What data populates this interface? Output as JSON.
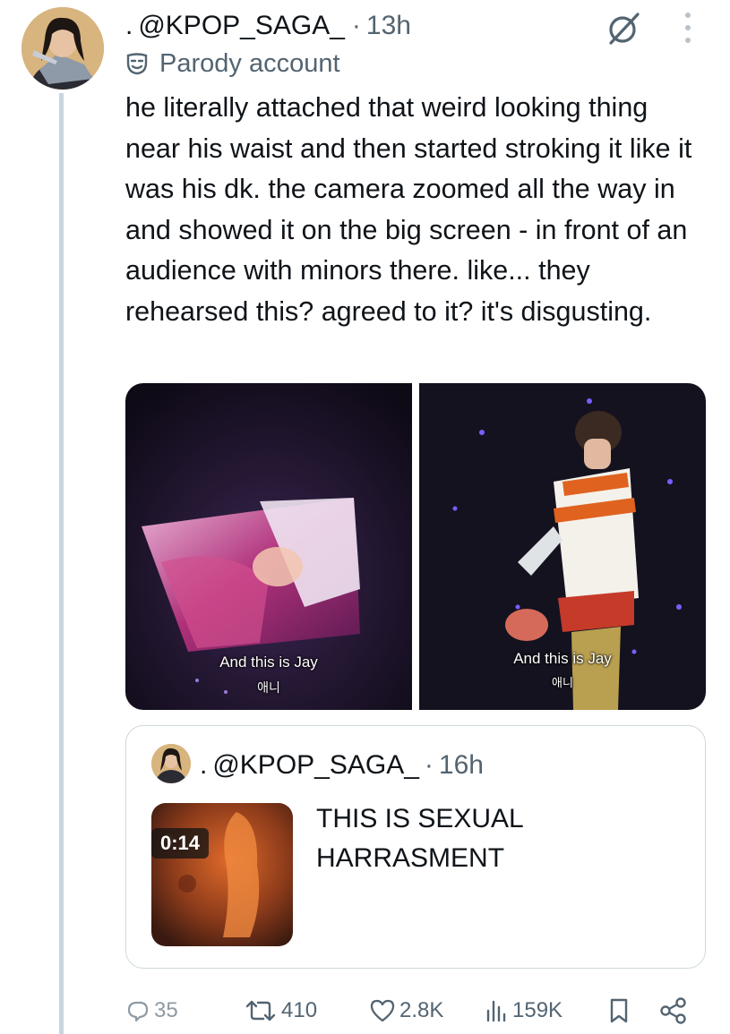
{
  "post": {
    "handle_prefix": ".",
    "handle": "@KPOP_SAGA_",
    "separator": "·",
    "time": "13h",
    "label": "Parody account",
    "text": "he literally attached that weird looking thing near his waist and then started stroking it like it was his dk. the camera zoomed all the way in and showed it on the big screen - in front of an audience with minors there. like... they rehearsed this? agreed to it? it's disgusting.",
    "media": [
      {
        "caption": "And this is Jay",
        "subcaption": "애니"
      },
      {
        "caption": "And this is Jay",
        "subcaption": "애니"
      }
    ]
  },
  "quote": {
    "handle_prefix": ".",
    "handle": "@KPOP_SAGA_",
    "separator": "·",
    "time": "16h",
    "text": "THIS IS SEXUAL HARRASMENT",
    "video_duration": "0:14"
  },
  "actions": {
    "replies": "35",
    "reposts": "410",
    "likes": "2.8K",
    "views": "159K"
  },
  "icons": {
    "grok": "grok-icon",
    "more": "more-icon",
    "parody": "parody-mask-icon",
    "reply": "reply-icon",
    "repost": "repost-icon",
    "like": "heart-icon",
    "views": "views-icon",
    "bookmark": "bookmark-icon",
    "share": "share-icon"
  },
  "colors": {
    "text": "#0f1419",
    "secondary": "#536471",
    "border": "#cfd9de",
    "thread": "#c9d5de"
  }
}
